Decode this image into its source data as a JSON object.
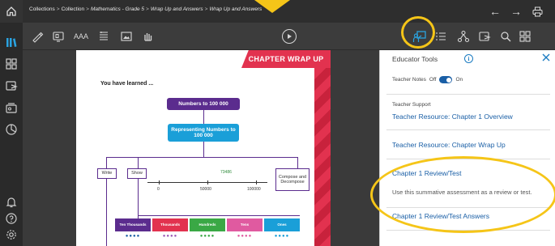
{
  "topbar": {
    "breadcrumbs": [
      {
        "label": "Collections",
        "italic": false
      },
      {
        "label": "Collection",
        "italic": false
      },
      {
        "label": "Mathematics - Grade 5",
        "italic": true
      },
      {
        "label": "Wrap Up and Answers",
        "italic": true
      },
      {
        "label": "Wrap Up and Answers",
        "italic": true
      }
    ],
    "separator": ">",
    "back_glyph": "←",
    "forward_glyph": "→"
  },
  "toolbar": {
    "text_size_label": "AAA"
  },
  "page": {
    "banner": "CHAPTER WRAP UP",
    "learned": "You have learned ...",
    "main_box": "Numbers to 100 000",
    "sub_box": "Representing Numbers to 100 000",
    "write": "Write",
    "show": "Show",
    "compose": "Compose and Decompose",
    "nl_zero": "0",
    "nl_mid": "50000",
    "nl_end": "100000",
    "nl_point": "73486",
    "place_values": [
      {
        "label": "Ten Thousands",
        "color": "#5b2c8e",
        "dots_color": "#1a5fa6"
      },
      {
        "label": "Thousands",
        "color": "#e2324f",
        "dots_color": "#9b59b6"
      },
      {
        "label": "Hundreds",
        "color": "#3aa845",
        "dots_color": "#3aa845"
      },
      {
        "label": "Tens",
        "color": "#e05aa0",
        "dots_color": "#e05aa0"
      },
      {
        "label": "Ones",
        "color": "#1a9fd8",
        "dots_color": "#1a9fd8"
      }
    ]
  },
  "panel": {
    "title": "Educator Tools",
    "notes_label": "Teacher Notes",
    "off": "Off",
    "on": "On",
    "support_label": "Teacher Support",
    "link1": "Teacher Resource: Chapter 1 Overview",
    "link2": "Teacher Resource: Chapter Wrap Up",
    "link3": "Chapter 1 Review/Test",
    "link3_desc": "Use this summative assessment as a review or test.",
    "link4": "Chapter 1 Review/Test Answers"
  },
  "colors": {
    "accent": "#1a5fa6",
    "highlight": "#f5c518",
    "brand_red": "#e2324f",
    "purple": "#5b2c8e"
  }
}
